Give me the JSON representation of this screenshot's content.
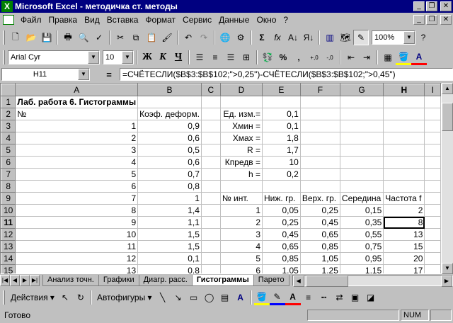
{
  "window": {
    "title": "Microsoft Excel - методичка ст. методы"
  },
  "menu": [
    "Файл",
    "Правка",
    "Вид",
    "Вставка",
    "Формат",
    "Сервис",
    "Данные",
    "Окно",
    "?"
  ],
  "toolbar": {
    "zoom": "100%",
    "font_name": "Arial Cyr",
    "font_size": "10"
  },
  "formula_bar": {
    "name_box": "H11",
    "equals": "=",
    "formula": "=СЧЁТЕСЛИ($B$3:$B$102;\">0,25\")-СЧЁТЕСЛИ($B$3:$B$102;\">0,45\")"
  },
  "sheet": {
    "columns": [
      "A",
      "B",
      "C",
      "D",
      "E",
      "F",
      "G",
      "H",
      "I"
    ],
    "active_column": "H",
    "active_row": "11",
    "rows": [
      {
        "n": "1",
        "cells": [
          "Лаб. работа 6. Гистограммы",
          "",
          "",
          "",
          "",
          "",
          "",
          "",
          ""
        ]
      },
      {
        "n": "2",
        "cells": [
          "№",
          "Коэф. деформ.",
          "",
          "Ед. изм.=",
          "0,1",
          "",
          "",
          "",
          ""
        ]
      },
      {
        "n": "3",
        "cells": [
          "1",
          "0,9",
          "",
          "Xмин =",
          "0,1",
          "",
          "",
          "",
          ""
        ]
      },
      {
        "n": "4",
        "cells": [
          "2",
          "0,6",
          "",
          "Xмах =",
          "1,8",
          "",
          "",
          "",
          ""
        ]
      },
      {
        "n": "5",
        "cells": [
          "3",
          "0,5",
          "",
          "R =",
          "1,7",
          "",
          "",
          "",
          ""
        ]
      },
      {
        "n": "6",
        "cells": [
          "4",
          "0,6",
          "",
          "Кпредв =",
          "10",
          "",
          "",
          "",
          ""
        ]
      },
      {
        "n": "7",
        "cells": [
          "5",
          "0,7",
          "",
          "h =",
          "0,2",
          "",
          "",
          "",
          ""
        ]
      },
      {
        "n": "8",
        "cells": [
          "6",
          "0,8",
          "",
          "",
          "",
          "",
          "",
          "",
          ""
        ]
      },
      {
        "n": "9",
        "cells": [
          "7",
          "1",
          "",
          "№ инт.",
          "Ниж. гр.",
          "Верх. гр.",
          "Середина",
          "Частота f",
          ""
        ]
      },
      {
        "n": "10",
        "cells": [
          "8",
          "1,4",
          "",
          "1",
          "0,05",
          "0,25",
          "0,15",
          "2",
          ""
        ]
      },
      {
        "n": "11",
        "cells": [
          "9",
          "1,1",
          "",
          "2",
          "0,25",
          "0,45",
          "0,35",
          "8",
          ""
        ]
      },
      {
        "n": "12",
        "cells": [
          "10",
          "1,5",
          "",
          "3",
          "0,45",
          "0,65",
          "0,55",
          "13",
          ""
        ]
      },
      {
        "n": "13",
        "cells": [
          "11",
          "1,5",
          "",
          "4",
          "0,65",
          "0,85",
          "0,75",
          "15",
          ""
        ]
      },
      {
        "n": "14",
        "cells": [
          "12",
          "0,1",
          "",
          "5",
          "0,85",
          "1,05",
          "0,95",
          "20",
          ""
        ]
      },
      {
        "n": "15",
        "cells": [
          "13",
          "0,8",
          "",
          "6",
          "1,05",
          "1,25",
          "1,15",
          "17",
          ""
        ]
      }
    ]
  },
  "tabs": [
    "Анализ точн.",
    "Графики",
    "Диагр. расс.",
    "Гистограммы",
    "Парето"
  ],
  "active_tab": "Гистограммы",
  "drawing": {
    "actions": "Действия",
    "autoshapes": "Автофигуры"
  },
  "status": {
    "text": "Готово",
    "num": "NUM"
  }
}
